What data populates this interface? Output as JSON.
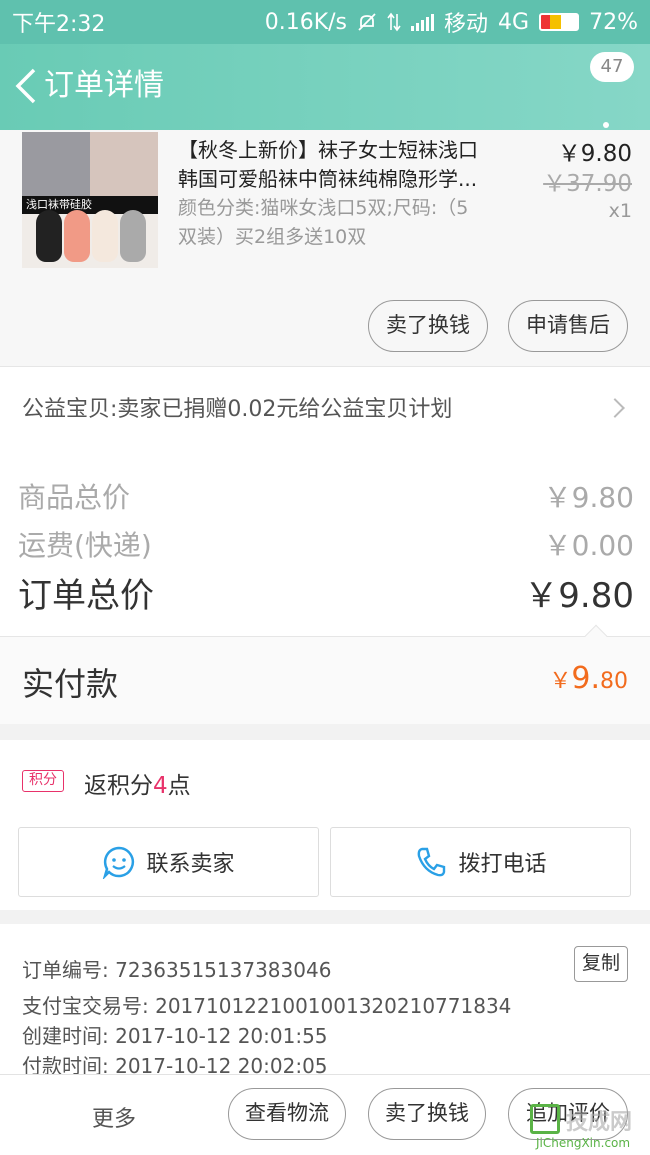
{
  "status_bar": {
    "time": "下午2:32",
    "speed": "0.16K/s",
    "carrier": "移动",
    "network": "4G",
    "battery": "72%"
  },
  "nav": {
    "title": "订单详情",
    "badge_count": "47"
  },
  "product": {
    "title_line1": "【秋冬上新价】袜子女士短袜浅口",
    "title_line2": "韩国可爱船袜中筒袜纯棉隐形学...",
    "attr_line1": "颜色分类:猫咪女浅口5双;尺码:（5",
    "attr_line2": "双装）买2组多送10双",
    "price": "￥9.80",
    "original_price": "￥37.90",
    "quantity": "x1",
    "thumb_banner": "浅口袜带硅胶",
    "sell_label": "卖了换钱",
    "after_sale_label": "申请售后"
  },
  "charity": {
    "text": "公益宝贝:卖家已捐赠0.02元给公益宝贝计划"
  },
  "summary": {
    "goods_label": "商品总价",
    "goods_value": "￥9.80",
    "shipping_label": "运费(快递)",
    "shipping_value": "￥0.00",
    "total_label": "订单总价",
    "total_value": "￥9.80"
  },
  "paid": {
    "label": "实付款",
    "currency": "￥",
    "amount_int": "9.",
    "amount_dec": "80"
  },
  "points": {
    "badge": "积分",
    "prefix": "返积分",
    "count": "4",
    "suffix": "点"
  },
  "contact": {
    "seller_label": "联系卖家",
    "phone_label": "拨打电话"
  },
  "order_info": {
    "order_no_label": "订单编号:",
    "order_no": "72363515137383046",
    "copy_label": "复制",
    "alipay_label": "支付宝交易号:",
    "alipay_no": "2017101221001001320210771834",
    "created_label": "创建时间:",
    "created": "2017-10-12 20:01:55",
    "paid_label": "付款时间:",
    "paid_time": "2017-10-12 20:02:05"
  },
  "bottom_bar": {
    "more": "更多",
    "logistics": "查看物流",
    "sell": "卖了换钱",
    "review": "追加评价"
  },
  "watermark": {
    "text": "技成网",
    "url": "JiChengXin.com"
  },
  "colors": {
    "header": "#69cbb5",
    "accent_orange": "#f26b1d",
    "points_pink": "#e8326a",
    "icon_blue": "#2aa0e6"
  }
}
